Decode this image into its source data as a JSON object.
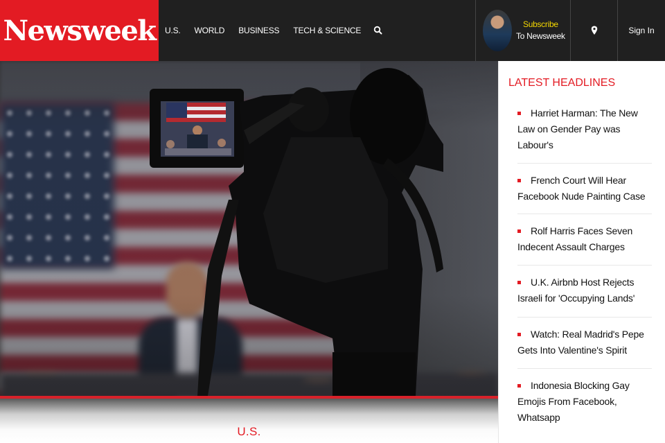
{
  "brand": {
    "logo_text": "Newsweek",
    "accent": "#e31b23",
    "nav_bg": "#202020"
  },
  "nav": {
    "items": [
      {
        "label": "U.S."
      },
      {
        "label": "WORLD"
      },
      {
        "label": "BUSINESS"
      },
      {
        "label": "TECH & SCIENCE"
      }
    ],
    "search_icon": "search-icon",
    "subscribe": {
      "line1": "Subscribe",
      "line2": "To Newsweek",
      "line1_color": "#f5d800"
    },
    "location_icon": "map-pin-icon",
    "signin_label": "Sign In"
  },
  "hero": {
    "section_label": "U.S."
  },
  "sidebar": {
    "title": "LATEST HEADLINES",
    "headlines": [
      {
        "text": "Harriet Harman: The New Law on Gender Pay was Labour's"
      },
      {
        "text": "French Court Will Hear Facebook Nude Painting Case"
      },
      {
        "text": "Rolf Harris Faces Seven Indecent Assault Charges"
      },
      {
        "text": "U.K. Airbnb Host Rejects Israeli for 'Occupying Lands'"
      },
      {
        "text": "Watch: Real Madrid's Pepe Gets Into Valentine's Spirit"
      },
      {
        "text": "Indonesia Blocking Gay Emojis From Facebook, Whatsapp"
      }
    ]
  }
}
